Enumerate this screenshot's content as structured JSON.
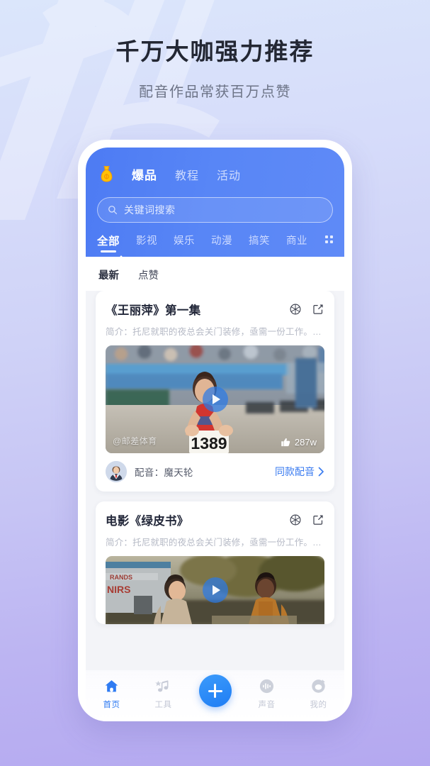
{
  "hero": {
    "title": "千万大咖强力推荐",
    "subtitle": "配音作品常获百万点赞"
  },
  "colors": {
    "header_blue": "#5886f6",
    "accent_blue": "#3a7bf0",
    "bg_top": "#dbe6fb",
    "bg_bottom": "#b4a8f0",
    "logo_yellow": "#ffc107"
  },
  "app": {
    "logo_icon": "money-bag-icon",
    "top_tabs": [
      {
        "label": "爆品",
        "active": true
      },
      {
        "label": "教程",
        "active": false
      },
      {
        "label": "活动",
        "active": false
      }
    ],
    "search": {
      "icon": "search-icon",
      "placeholder": "关键词搜索",
      "value": ""
    },
    "categories": [
      {
        "label": "全部",
        "active": true
      },
      {
        "label": "影视",
        "active": false
      },
      {
        "label": "娱乐",
        "active": false
      },
      {
        "label": "动漫",
        "active": false
      },
      {
        "label": "搞笑",
        "active": false
      },
      {
        "label": "商业",
        "active": false
      }
    ],
    "category_more_icon": "grid-dots-icon",
    "sorts": [
      {
        "label": "最新",
        "active": true
      },
      {
        "label": "点赞",
        "active": false
      }
    ],
    "cards": [
      {
        "title": "《王丽萍》第一集",
        "desc": "简介：托尼就职的夜总会关门装修，亟需一份工作。…",
        "aperture_icon": "aperture-icon",
        "share_icon": "share-icon",
        "play_icon": "play-icon",
        "watermark": "@邮差体育",
        "like_icon": "thumbs-up-icon",
        "likes": "287w",
        "dub_label": "配音：魔天轮",
        "dub_link": "同款配音",
        "dub_link_icon": "chevron-right-icon",
        "avatar_icon": "avatar"
      },
      {
        "title": "电影《绿皮书》",
        "desc": "简介：托尼就职的夜总会关门装修，亟需一份工作。…",
        "aperture_icon": "aperture-icon",
        "share_icon": "share-icon",
        "play_icon": "play-icon"
      }
    ],
    "bottom_nav": [
      {
        "label": "首页",
        "icon": "home-icon",
        "active": true
      },
      {
        "label": "工具",
        "icon": "music-note-icon",
        "active": false
      },
      {
        "label": "",
        "icon": "plus-icon",
        "active": false
      },
      {
        "label": "声音",
        "icon": "sound-wave-icon",
        "active": false
      },
      {
        "label": "我的",
        "icon": "user-icon",
        "active": false
      }
    ]
  }
}
